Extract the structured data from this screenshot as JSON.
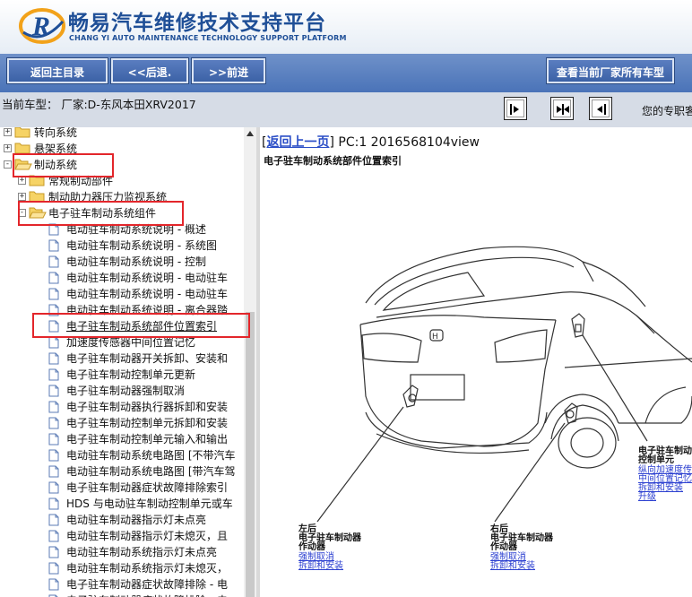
{
  "header": {
    "title": "畅易汽车维修技术支持平台",
    "subtitle": "CHANG YI AUTO MAINTENANCE TECHNOLOGY SUPPORT PLATFORM",
    "logo_letter": "R"
  },
  "toolbar": {
    "home_label": "返回主目录",
    "back_label": "<<后退.",
    "forward_label": ">>前进",
    "all_models_label": "查看当前厂家所有车型"
  },
  "infobar": {
    "model_text": "当前车型： 厂家:D-东风本田XRV2017",
    "promo_text": "您的专职客"
  },
  "tree": {
    "items": [
      {
        "label": "转向系统",
        "pm": "+"
      },
      {
        "label": "悬架系统",
        "pm": "+"
      },
      {
        "label": "制动系统",
        "pm": "-"
      },
      {
        "label": "常规制动部件",
        "pm": "+"
      },
      {
        "label": "制动助力器压力监视系统",
        "pm": "+"
      },
      {
        "label": "电子驻车制动系统组件",
        "pm": "-"
      },
      {
        "label": "电动驻车制动系统说明 - 概述"
      },
      {
        "label": "电动驻车制动系统说明 - 系统图"
      },
      {
        "label": "电动驻车制动系统说明 - 控制"
      },
      {
        "label": "电动驻车制动系统说明 - 电动驻车"
      },
      {
        "label": "电动驻车制动系统说明 - 电动驻车"
      },
      {
        "label": "电动驻车制动系统说明 - 离合器踏"
      },
      {
        "label": "电子驻车制动系统部件位置索引"
      },
      {
        "label": "加速度传感器中间位置记忆"
      },
      {
        "label": "电子驻车制动器开关拆卸、安装和"
      },
      {
        "label": "电子驻车制动控制单元更新"
      },
      {
        "label": "电子驻车制动器强制取消"
      },
      {
        "label": "电子驻车制动器执行器拆卸和安装"
      },
      {
        "label": "电子驻车制动控制单元拆卸和安装"
      },
      {
        "label": "电子驻车制动控制单元输入和输出"
      },
      {
        "label": "电动驻车制动系统电路图 [不带汽车"
      },
      {
        "label": "电动驻车制动系统电路图 [带汽车驾"
      },
      {
        "label": "电子驻车制动器症状故障排除索引"
      },
      {
        "label": "HDS 与电动驻车制动控制单元或车"
      },
      {
        "label": "电动驻车制动器指示灯未点亮"
      },
      {
        "label": "电动驻车制动器指示灯未熄灭，且"
      },
      {
        "label": "电动驻车制动系统指示灯未点亮"
      },
      {
        "label": "电动驻车制动系统指示灯未熄灭，"
      },
      {
        "label": "电子驻车制动器症状故障排除 - 电"
      },
      {
        "label": "电子驻车制动器症状故障排除 - 电"
      }
    ]
  },
  "content": {
    "back_link": "返回上一页",
    "page_info": "PC:1 2016568104view",
    "doc_title": "电子驻车制动系统部件位置索引",
    "callouts": {
      "left_rear": {
        "lines": [
          "左后",
          "电子驻车制动器",
          "作动器"
        ],
        "links": [
          "强制取消",
          "拆卸和安装"
        ]
      },
      "right_rear": {
        "lines": [
          "右后",
          "电子驻车制动器",
          "作动器"
        ],
        "links": [
          "强制取消",
          "拆卸和安装"
        ]
      },
      "control_unit": {
        "lines": [
          "电子驻车制动",
          "控制单元"
        ],
        "links": [
          "纵向加速度传",
          "中间位置记忆",
          "拆卸和安装",
          "升级"
        ]
      }
    }
  },
  "colors": {
    "brand_blue": "#1f4f97",
    "toolbar_blue": "#4a73b8",
    "highlight_red": "#e3262b",
    "link_blue": "#2b4ec7"
  }
}
